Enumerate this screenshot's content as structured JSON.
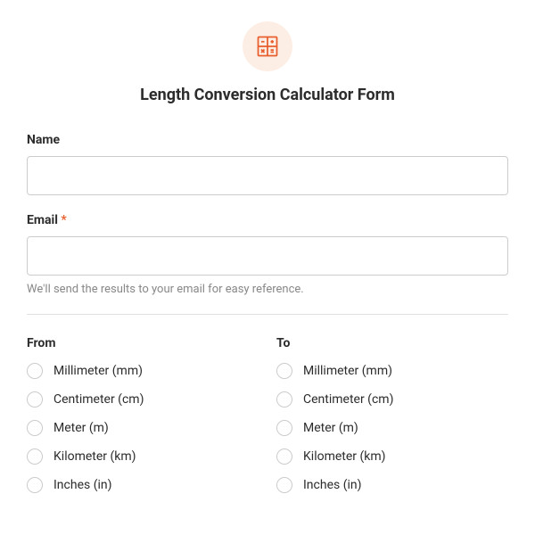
{
  "title": "Length Conversion Calculator Form",
  "fields": {
    "name": {
      "label": "Name",
      "value": "",
      "required": false
    },
    "email": {
      "label": "Email",
      "value": "",
      "required": true,
      "helper": "We'll send the results to your email for easy reference."
    }
  },
  "requiredMark": "*",
  "from": {
    "label": "From",
    "options": [
      "Millimeter (mm)",
      "Centimeter (cm)",
      "Meter (m)",
      "Kilometer (km)",
      "Inches (in)"
    ]
  },
  "to": {
    "label": "To",
    "options": [
      "Millimeter (mm)",
      "Centimeter (cm)",
      "Meter (m)",
      "Kilometer (km)",
      "Inches (in)"
    ]
  }
}
